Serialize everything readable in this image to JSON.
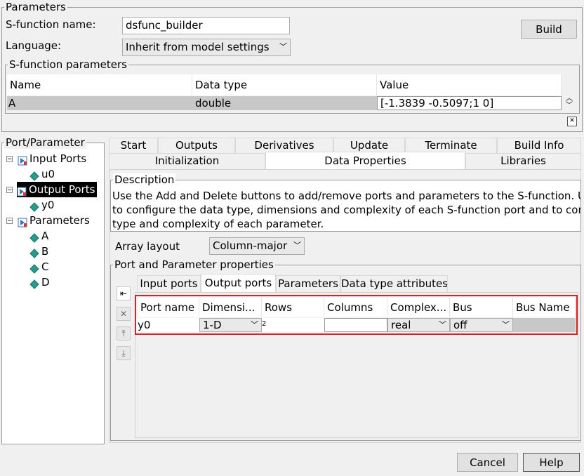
{
  "parameters": {
    "legend": "Parameters",
    "sfunction_name_label": "S-function name:",
    "sfunction_name_value": "dsfunc_builder",
    "language_label": "Language:",
    "language_value": "Inherit from model settings",
    "build_label": "Build"
  },
  "sfunc_params": {
    "legend": "S-function parameters",
    "columns": [
      "Name",
      "Data type",
      "Value"
    ],
    "row": {
      "name": "A",
      "data_type": "double",
      "value": "[-1.3839 -0.5097;1 0]"
    },
    "close_glyph": "✕"
  },
  "tree": {
    "legend": "Port/Parameter",
    "items": [
      {
        "label": "Input Ports",
        "icon": "input-port-icon"
      },
      {
        "label": "u0",
        "icon": "port-diamond-icon"
      },
      {
        "label": "Output Ports",
        "icon": "output-port-icon"
      },
      {
        "label": "y0",
        "icon": "port-diamond-icon"
      },
      {
        "label": "Parameters",
        "icon": "parameters-icon"
      },
      {
        "label": "A",
        "icon": "param-diamond-icon"
      },
      {
        "label": "B",
        "icon": "param-diamond-icon"
      },
      {
        "label": "C",
        "icon": "param-diamond-icon"
      },
      {
        "label": "D",
        "icon": "param-diamond-icon"
      }
    ]
  },
  "tabs_row1": [
    "Start",
    "Outputs",
    "Derivatives",
    "Update",
    "Terminate",
    "Build Info"
  ],
  "tabs_row2": [
    "Initialization",
    "Data Properties",
    "Libraries"
  ],
  "selected_tab": "Data Properties",
  "description": {
    "legend": "Description",
    "line1": "Use the Add and Delete buttons to add/remove ports and parameters to the S-function. Use",
    "line2": "to configure the data type, dimensions and complexity of each S-function port and to config",
    "line3": "type and complexity of each parameter."
  },
  "array_layout": {
    "label": "Array layout",
    "value": "Column-major"
  },
  "port_param_props": {
    "legend": "Port and Parameter properties",
    "tabs": [
      "Input ports",
      "Output ports",
      "Parameters",
      "Data type attributes"
    ],
    "selected_tab": "Output ports",
    "columns": [
      "Port name",
      "Dimensi...",
      "Rows",
      "Columns",
      "Complex...",
      "Bus",
      "Bus Name"
    ],
    "row": {
      "port_name": "y0",
      "dimensions": "1-D",
      "rows": "2",
      "columns": "",
      "complexity": "real",
      "bus": "off",
      "bus_name": ""
    }
  },
  "footer": {
    "cancel_label": "Cancel",
    "help_label": "Help"
  },
  "colors": {
    "highlight_border": "#e02020",
    "selected_tree_bg": "#000000",
    "selected_row_bg": "#c8c8c8"
  }
}
